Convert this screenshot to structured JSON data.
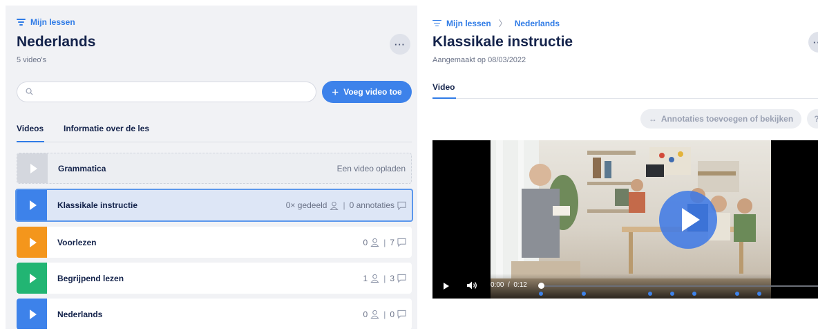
{
  "left": {
    "breadcrumb": "Mijn lessen",
    "title": "Nederlands",
    "subtitle": "5 video's",
    "more": "···",
    "search": {
      "placeholder": ""
    },
    "add_button": "Voeg video toe",
    "tabs": [
      "Videos",
      "Informatie over de les"
    ],
    "rows": [
      {
        "title": "Grammatica",
        "status": "Een video opladen",
        "color": "#d4d7de"
      },
      {
        "title": "Klassikale instructie",
        "shares": "0× gedeeld",
        "annotations": "0 annotaties",
        "color": "#3d82ea"
      },
      {
        "title": "Voorlezen",
        "shares": "0",
        "annotations": "7",
        "color": "#f4961c"
      },
      {
        "title": "Begrijpend lezen",
        "shares": "1",
        "annotations": "3",
        "color": "#22b573"
      },
      {
        "title": "Nederlands",
        "shares": "0",
        "annotations": "0",
        "color": "#3d82ea"
      }
    ]
  },
  "right": {
    "breadcrumb": [
      "Mijn lessen",
      "Nederlands"
    ],
    "breadcrumb_sep": "〉",
    "title": "Klassikale instructie",
    "created": "Aangemaakt op 08/03/2022",
    "more": "···",
    "tab": "Video",
    "annot_button": "Annotaties toevoegen of bekijken",
    "help": "?",
    "player": {
      "time_current": "0:00",
      "time_sep": "/",
      "time_total": "0:12",
      "progress": 0
    }
  },
  "colors": {
    "accent": "#3d82ea",
    "link": "#2f7be6",
    "text": "#14234b"
  }
}
